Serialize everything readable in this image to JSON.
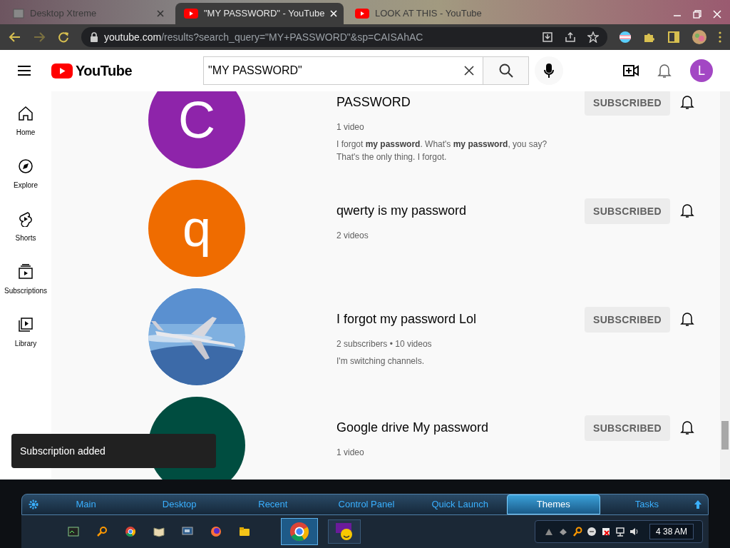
{
  "browser": {
    "tabs": [
      {
        "title": "Desktop Xtreme",
        "selected": false
      },
      {
        "title": "\"MY PASSWORD\" - YouTube",
        "selected": true
      },
      {
        "title": "LOOK AT THIS - YouTube",
        "selected": false
      }
    ],
    "url_host": "youtube.com",
    "url_path": "/results?search_query=\"MY+PASSWORD\"&sp=CAISAhAC"
  },
  "header": {
    "logo": "YouTube",
    "search_value": "\"MY PASSWORD\"",
    "avatar": "L"
  },
  "sidebar": {
    "items": [
      {
        "label": "Home"
      },
      {
        "label": "Explore"
      },
      {
        "label": "Shorts"
      },
      {
        "label": "Subscriptions"
      },
      {
        "label": "Library"
      }
    ]
  },
  "channels": [
    {
      "kind": "letter",
      "letter": "C",
      "color": "#8e24aa",
      "title": "PASSWORD",
      "meta": "1 video",
      "description": "I forgot **my password**. What's **my password**, you say? That's the only thing. I forgot.",
      "button": "SUBSCRIBED"
    },
    {
      "kind": "letter",
      "letter": "q",
      "color": "#ef6c00",
      "title": "qwerty is my password",
      "meta": "2 videos",
      "button": "SUBSCRIBED"
    },
    {
      "kind": "picture",
      "title": "I forgot my password Lol",
      "meta": "2 subscribers • 10 videos",
      "description": "I'm switching channels.",
      "button": "SUBSCRIBED"
    },
    {
      "kind": "letter",
      "color": "#004d40",
      "title": "Google drive My password",
      "meta": "1 video",
      "button": "SUBSCRIBED"
    }
  ],
  "toast": "Subscription added",
  "taskbar": {
    "tabs": [
      {
        "label": "Main",
        "selected": false
      },
      {
        "label": "Desktop",
        "selected": false
      },
      {
        "label": "Recent",
        "selected": false
      },
      {
        "label": "Control Panel",
        "selected": false
      },
      {
        "label": "Quick Launch",
        "selected": false
      },
      {
        "label": "Themes",
        "selected": true
      },
      {
        "label": "Tasks",
        "selected": false
      }
    ],
    "clock": "4 38 AM"
  }
}
